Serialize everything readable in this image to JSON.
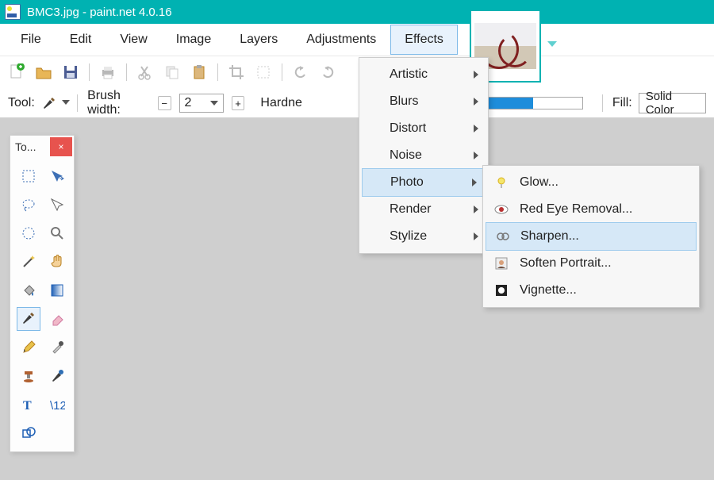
{
  "app": {
    "title": "BMC3.jpg - paint.net 4.0.16"
  },
  "menu": {
    "file": "File",
    "edit": "Edit",
    "view": "View",
    "image": "Image",
    "layers": "Layers",
    "adjustments": "Adjustments",
    "effects": "Effects"
  },
  "options": {
    "tool_label": "Tool:",
    "brush_width_label": "Brush width:",
    "brush_width_value": "2",
    "hardness_label": "Hardne",
    "fill_label": "Fill:",
    "fill_value": "Solid Color"
  },
  "tools_panel": {
    "title": "To...",
    "close": "×"
  },
  "effects_menu": {
    "items": [
      {
        "label": "Artistic"
      },
      {
        "label": "Blurs"
      },
      {
        "label": "Distort"
      },
      {
        "label": "Noise"
      },
      {
        "label": "Photo"
      },
      {
        "label": "Render"
      },
      {
        "label": "Stylize"
      }
    ]
  },
  "photo_submenu": {
    "items": [
      {
        "label": "Glow..."
      },
      {
        "label": "Red Eye Removal..."
      },
      {
        "label": "Sharpen..."
      },
      {
        "label": "Soften Portrait..."
      },
      {
        "label": "Vignette..."
      }
    ]
  }
}
